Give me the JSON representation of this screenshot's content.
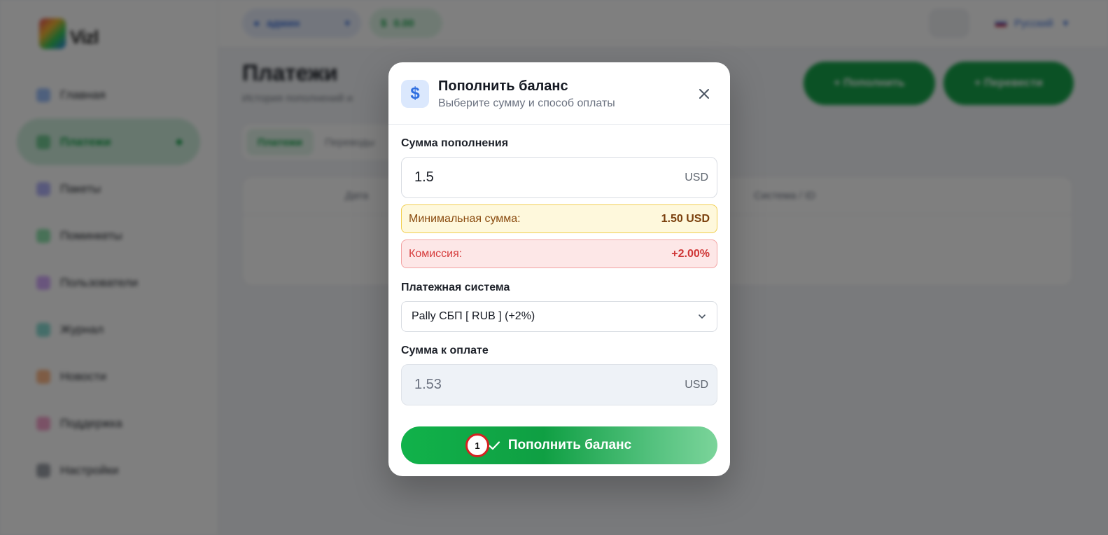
{
  "background": {
    "logo_text": "Vizl",
    "sidebar": {
      "items": [
        {
          "label": "Главная",
          "color": "#3b82f6"
        },
        {
          "label": "Платежи",
          "color": "#16a34a",
          "active": true
        },
        {
          "label": "Пакеты",
          "color": "#6366f1"
        },
        {
          "label": "Поминкеты",
          "color": "#22c55e"
        },
        {
          "label": "Пользователи",
          "color": "#a855f7"
        },
        {
          "label": "Журнал",
          "color": "#14b8a6"
        },
        {
          "label": "Новости",
          "color": "#f97316"
        },
        {
          "label": "Поддержка",
          "color": "#ec4899"
        },
        {
          "label": "Настройки",
          "color": "#374151"
        }
      ]
    },
    "topbar": {
      "user": "админ",
      "balance": "0.00",
      "language": "Русский"
    },
    "page": {
      "title": "Платежи",
      "subtitle": "История пополнений и",
      "btn_topup": "+ Пополнить",
      "btn_transfer": "+ Перевести",
      "tabs": [
        "Платежи",
        "Переводы"
      ],
      "table_headers": [
        "Дата",
        "Система / ID"
      ]
    }
  },
  "modal": {
    "icon": "dollar-icon",
    "title": "Пополнить баланс",
    "subtitle": "Выберите сумму и способ оплаты",
    "amount_label": "Сумма пополнения",
    "amount_value": "1.5",
    "amount_unit": "USD",
    "min_label": "Минимальная сумма:",
    "min_value": "1.50 USD",
    "fee_label": "Комиссия:",
    "fee_value": "+2.00%",
    "system_label": "Платежная система",
    "system_value": "Pally СБП [ RUB ] (+2%)",
    "pay_label": "Сумма к оплате",
    "pay_value": "1.53",
    "pay_unit": "USD",
    "submit_label": "Пополнить баланс",
    "marker": "1"
  }
}
